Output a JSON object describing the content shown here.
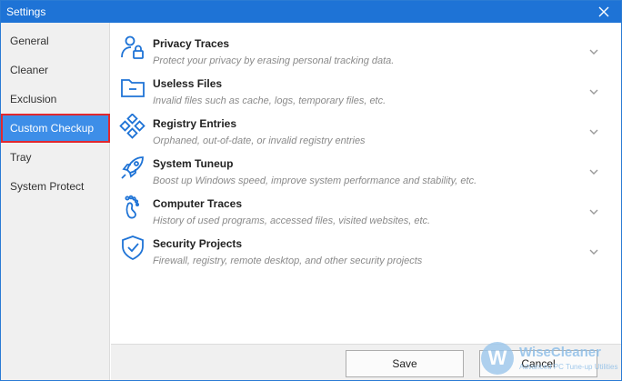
{
  "window": {
    "title": "Settings"
  },
  "sidebar": {
    "items": [
      {
        "label": "General"
      },
      {
        "label": "Cleaner"
      },
      {
        "label": "Exclusion"
      },
      {
        "label": "Custom Checkup",
        "selected": true
      },
      {
        "label": "Tray"
      },
      {
        "label": "System Protect"
      }
    ]
  },
  "sections": [
    {
      "name": "Privacy Traces",
      "desc": "Protect your privacy by erasing personal tracking data.",
      "icon": "user-lock-icon"
    },
    {
      "name": "Useless Files",
      "desc": "Invalid files such as cache, logs, temporary files, etc.",
      "icon": "folder-icon"
    },
    {
      "name": "Registry Entries",
      "desc": "Orphaned, out-of-date, or invalid registry entries",
      "icon": "registry-cubes-icon"
    },
    {
      "name": "System Tuneup",
      "desc": "Boost up Windows speed, improve system performance and stability, etc.",
      "icon": "rocket-icon"
    },
    {
      "name": "Computer Traces",
      "desc": "History of used programs, accessed files, visited websites, etc.",
      "icon": "footprint-icon"
    },
    {
      "name": "Security Projects",
      "desc": "Firewall, registry, remote desktop, and other security projects",
      "icon": "shield-check-icon"
    }
  ],
  "footer": {
    "save_label": "Save",
    "cancel_label": "Cancel"
  },
  "watermark": {
    "brand": "WiseCleaner",
    "tagline": "Advanced PC Tune-up Utilities",
    "logo_letter": "W"
  },
  "colors": {
    "titlebar": "#1e73d6",
    "selected": "#3d8ee8",
    "highlight_border": "#e2282e",
    "icon": "#1e73d6"
  }
}
